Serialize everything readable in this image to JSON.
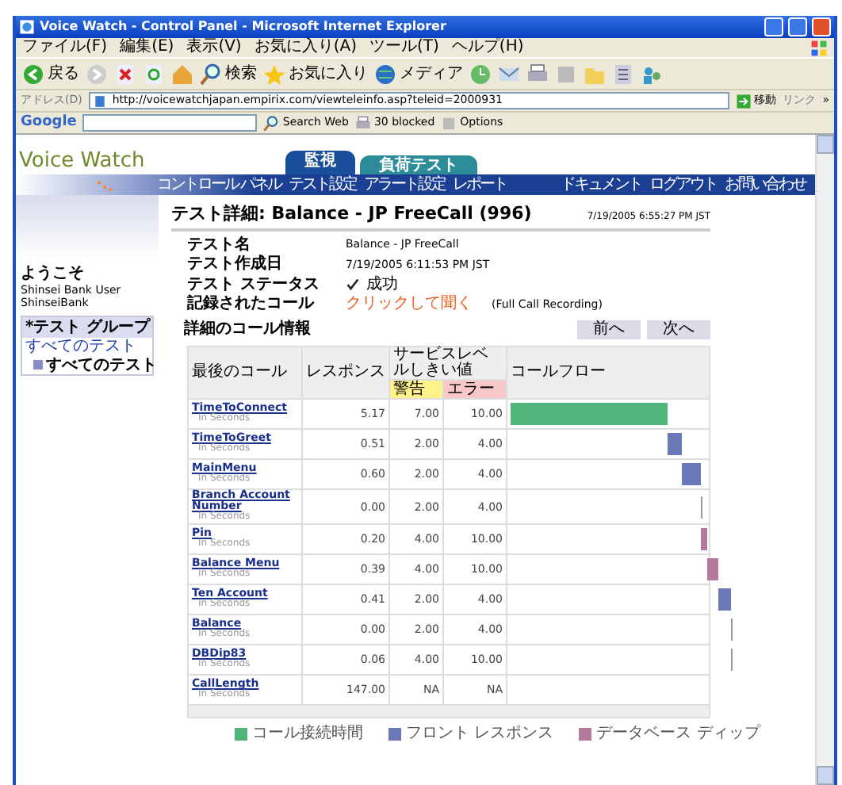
{
  "window": {
    "title": "Voice Watch - Control Panel - Microsoft Internet Explorer"
  },
  "menu_bar": [
    "ファイル(F)",
    "編集(E)",
    "表示(V)",
    "お気に入り(A)",
    "ツール(T)",
    "ヘルプ(H)"
  ],
  "toolbar": [
    {
      "kind": "back",
      "label": "戻る"
    },
    {
      "kind": "forward"
    },
    {
      "kind": "stop"
    },
    {
      "kind": "refresh"
    },
    {
      "kind": "home"
    },
    {
      "kind": "search",
      "label": "検索"
    },
    {
      "kind": "favorites",
      "label": "お気に入り"
    },
    {
      "kind": "media",
      "label": "メディア"
    },
    {
      "kind": "history"
    },
    {
      "kind": "mail"
    },
    {
      "kind": "print"
    },
    {
      "kind": "edit"
    },
    {
      "kind": "folder"
    },
    {
      "kind": "tools"
    },
    {
      "kind": "people"
    }
  ],
  "address_bar": {
    "label": "アドレス(D)",
    "url": "http://voicewatchjapan.empirix.com/viewteleinfo.asp?teleid=2000931",
    "go": "移動",
    "links": "リンク",
    "more": "»"
  },
  "google_bar": {
    "logo": "Google",
    "search": "Search Web",
    "blocked": "30 blocked",
    "options": "Options"
  },
  "site": {
    "logo": "Voice Watch",
    "tabs": [
      {
        "label": "監視",
        "selected": true
      },
      {
        "label": "負荷テスト",
        "selected": false
      }
    ],
    "nav": [
      "コントロール パネル",
      "テスト設定",
      "アラート設定",
      "レポート"
    ],
    "nav_right": [
      "ドキュメント",
      "ログアウト",
      "お問い合わせ"
    ]
  },
  "sidebar": {
    "welcome": "ようこそ",
    "user": "Shinsei Bank User",
    "company": "ShinseiBank",
    "group_title": "*テスト グループ",
    "tree": [
      {
        "label": "すべてのテスト",
        "selected": false,
        "children": [
          {
            "label": "すべてのテスト",
            "selected": true
          }
        ]
      }
    ]
  },
  "details": {
    "title": "テスト詳細: Balance - JP FreeCall (996)",
    "timestamp": "7/19/2005 6:55:27 PM JST",
    "fields": [
      {
        "kind": "text",
        "label": "テスト名",
        "value": "Balance - JP FreeCall"
      },
      {
        "kind": "text",
        "label": "テスト作成日",
        "value": "7/19/2005 6:11:53 PM JST"
      },
      {
        "kind": "status",
        "label": "テスト ステータス",
        "value": "成功"
      },
      {
        "kind": "link",
        "label": "記録されたコール",
        "value": "クリックして聞く",
        "note": "(Full Call Recording)"
      }
    ]
  },
  "call_table": {
    "title": "詳細のコール情報",
    "buttons": [
      "前へ",
      "次へ"
    ],
    "columns": {
      "call": "最後のコール",
      "response": "レスポンス",
      "threshold": "サービスレベルしきい値",
      "warning": "警告",
      "error": "エラー",
      "flow": "コールフロー"
    },
    "rows": [
      {
        "name": "TimeToConnect",
        "unit": "In Seconds",
        "response": "5.17",
        "warning": "7.00",
        "error": "10.00",
        "kind": "connect"
      },
      {
        "name": "TimeToGreet",
        "unit": "In Seconds",
        "response": "0.51",
        "warning": "2.00",
        "error": "4.00",
        "kind": "front"
      },
      {
        "name": "MainMenu",
        "unit": "In Seconds",
        "response": "0.60",
        "warning": "2.00",
        "error": "4.00",
        "kind": "front"
      },
      {
        "name": "Branch Account Number",
        "unit": "In Seconds",
        "response": "0.00",
        "warning": "2.00",
        "error": "4.00",
        "kind": "front"
      },
      {
        "name": "Pin",
        "unit": "In Seconds",
        "response": "0.20",
        "warning": "4.00",
        "error": "10.00",
        "kind": "db"
      },
      {
        "name": "Balance Menu",
        "unit": "In Seconds",
        "response": "0.39",
        "warning": "4.00",
        "error": "10.00",
        "kind": "db"
      },
      {
        "name": "Ten Account",
        "unit": "In Seconds",
        "response": "0.41",
        "warning": "2.00",
        "error": "4.00",
        "kind": "front"
      },
      {
        "name": "Balance",
        "unit": "In Seconds",
        "response": "0.00",
        "warning": "2.00",
        "error": "4.00",
        "kind": "front"
      },
      {
        "name": "DBDip83",
        "unit": "In Seconds",
        "response": "0.06",
        "warning": "4.00",
        "error": "10.00",
        "kind": "db"
      },
      {
        "name": "CallLength",
        "unit": "In Seconds",
        "response": "147.00",
        "warning": "NA",
        "error": "NA",
        "kind": "total"
      }
    ]
  },
  "legend": [
    {
      "kind": "connect",
      "label": "コール接続時間",
      "color": "#4fb57a"
    },
    {
      "kind": "front",
      "label": "フロント レスポンス",
      "color": "#6b78b8"
    },
    {
      "kind": "db",
      "label": "データベース ディップ",
      "color": "#b57a9b"
    }
  ]
}
